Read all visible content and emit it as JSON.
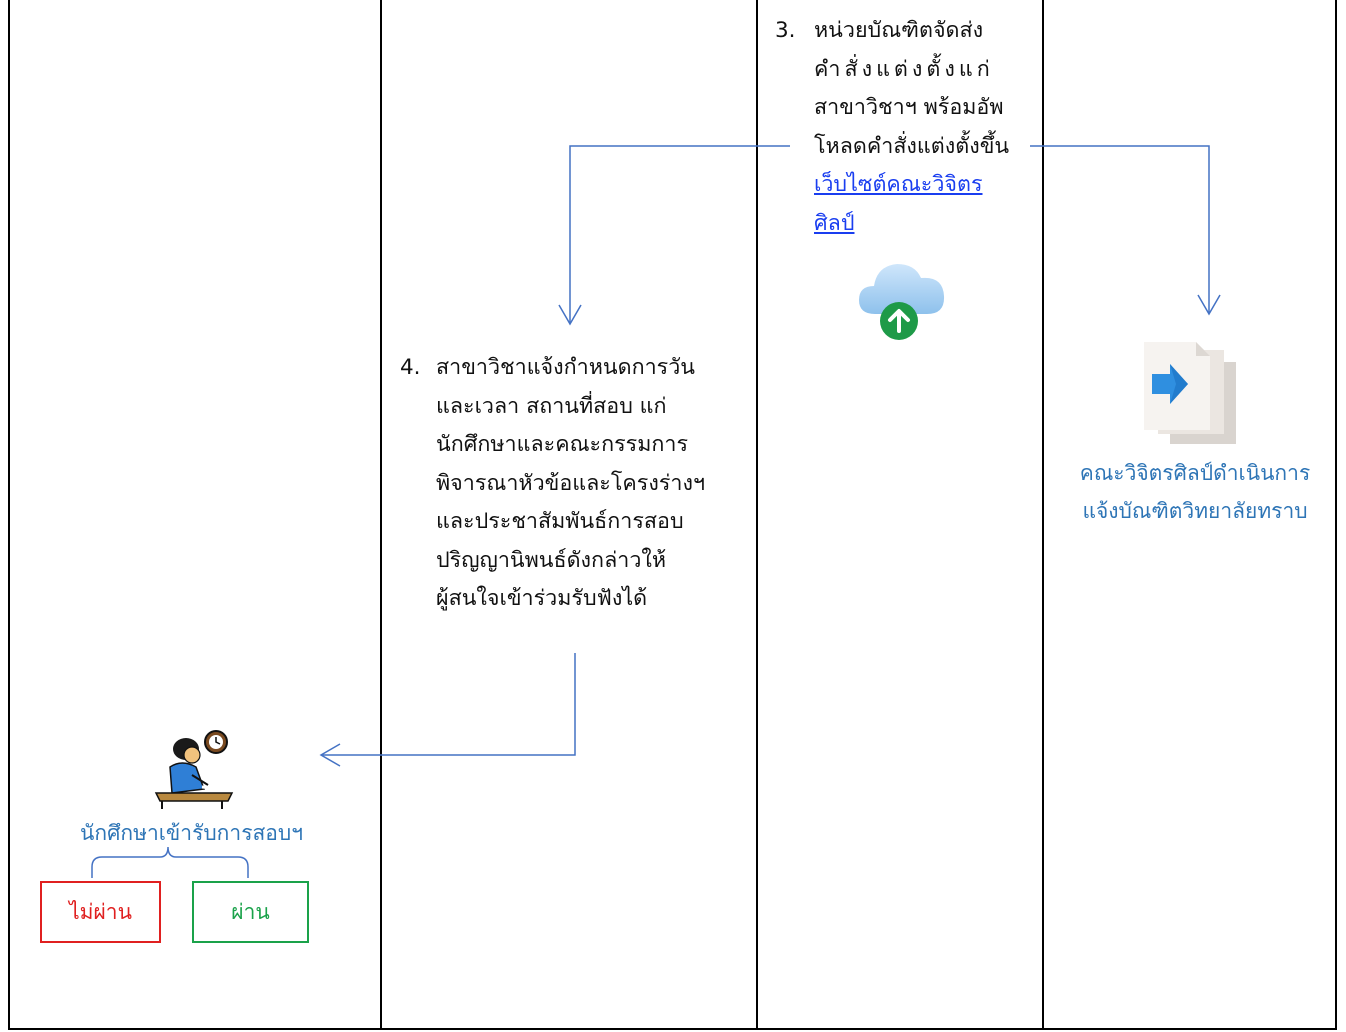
{
  "step3": {
    "number": "3.",
    "lines": [
      "หน่วยบัณฑิตจัดส่ง",
      "คำสั่งแต่งตั้งแก่",
      "สาขาวิชาฯ พร้อมอัพ",
      "โหลดคำสั่งแต่งตั้งขึ้น"
    ],
    "link_lines": [
      "เว็บไซต์คณะวิจิตร",
      "ศิลป์"
    ]
  },
  "step4": {
    "number": "4.",
    "lines": [
      "สาขาวิชาแจ้งกำหนดการวัน",
      "และเวลา สถานที่สอบ แก่",
      "นักศึกษาและคณะกรรมการ",
      "พิจารณาหัวข้อและโครงร่างฯ",
      "และประชาสัมพันธ์การสอบ",
      "ปริญญานิพนธ์ดังกล่าวให้",
      "ผู้สนใจเข้าร่วมรับฟังได้"
    ]
  },
  "faculty_notice": {
    "lines": [
      "คณะวิจิตรศิลป์ดำเนินการ",
      "แจ้งบัณฑิตวิทยาลัยทราบ"
    ]
  },
  "student": {
    "label": "นักศึกษาเข้ารับการสอบฯ",
    "fail_label": "ไม่ผ่าน",
    "pass_label": "ผ่าน"
  },
  "colors": {
    "arrow": "#4472c4",
    "label_blue": "#2e75b6",
    "fail": "#e02020",
    "pass": "#1aa24a",
    "link": "#1a3ef0"
  },
  "icons": {
    "upload": "cloud-upload-icon",
    "document": "document-send-icon",
    "student": "student-writing-icon"
  }
}
